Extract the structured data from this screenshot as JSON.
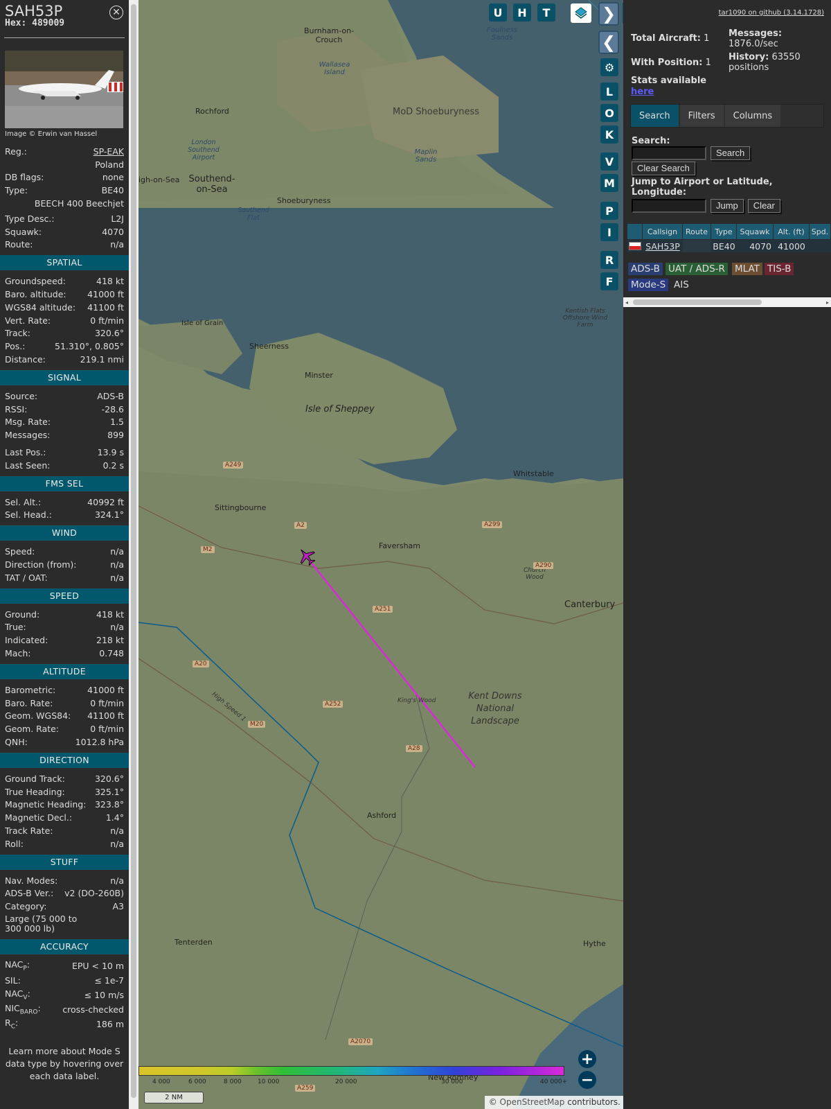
{
  "sidebar": {
    "callsign": "SAH53P",
    "hex_label": "Hex:",
    "hex": "489009",
    "image_credit": "Image © Erwin van Hassel",
    "reg_label": "Reg.:",
    "reg": "SP-EAK",
    "country": "Poland",
    "dbflags_label": "DB flags:",
    "dbflags": "none",
    "type_label": "Type:",
    "type": "BE40",
    "type_full": "BEECH 400 Beechjet",
    "typedesc_label": "Type Desc.:",
    "typedesc": "L2J",
    "squawk_label": "Squawk:",
    "squawk": "4070",
    "route_label": "Route:",
    "route": "n/a",
    "spatial_title": "SPATIAL",
    "gs_label": "Groundspeed:",
    "gs": "418 kt",
    "baro_label": "Baro. altitude:",
    "baro": "41000 ft",
    "wgs_label": "WGS84 altitude:",
    "wgs": "41100 ft",
    "vr_label": "Vert. Rate:",
    "vr": "0 ft/min",
    "track_label": "Track:",
    "track": "320.6°",
    "pos_label": "Pos.:",
    "pos": "51.310°, 0.805°",
    "dist_label": "Distance:",
    "dist": "219.1 nmi",
    "signal_title": "SIGNAL",
    "source_label": "Source:",
    "source": "ADS-B",
    "rssi_label": "RSSI:",
    "rssi": "-28.6",
    "msgrate_label": "Msg. Rate:",
    "msgrate": "1.5",
    "messages_label": "Messages:",
    "messages": "899",
    "lastpos_label": "Last Pos.:",
    "lastpos": "13.9 s",
    "lastseen_label": "Last Seen:",
    "lastseen": "0.2 s",
    "fms_title": "FMS SEL",
    "selalt_label": "Sel. Alt.:",
    "selalt": "40992 ft",
    "selhead_label": "Sel. Head.:",
    "selhead": "324.1°",
    "wind_title": "WIND",
    "wspeed_label": "Speed:",
    "wspeed": "n/a",
    "wdir_label": "Direction (from):",
    "wdir": "n/a",
    "tat_label": "TAT / OAT:",
    "tat": "n/a",
    "speed_title": "SPEED",
    "ground_label": "Ground:",
    "ground": "418 kt",
    "true_label": "True:",
    "true": "n/a",
    "ias_label": "Indicated:",
    "ias": "218 kt",
    "mach_label": "Mach:",
    "mach": "0.748",
    "alt_title": "ALTITUDE",
    "abaro_label": "Barometric:",
    "abaro": "41000 ft",
    "abrate_label": "Baro. Rate:",
    "abrate": "0 ft/min",
    "ageom_label": "Geom. WGS84:",
    "ageom": "41100 ft",
    "agrate_label": "Geom. Rate:",
    "agrate": "0 ft/min",
    "qnh_label": "QNH:",
    "qnh": "1012.8 hPa",
    "dir_title": "DIRECTION",
    "gtrack_label": "Ground Track:",
    "gtrack": "320.6°",
    "thead_label": "True Heading:",
    "thead": "325.1°",
    "mhead_label": "Magnetic Heading:",
    "mhead": "323.8°",
    "mdecl_label": "Magnetic Decl.:",
    "mdecl": "1.4°",
    "trate_label": "Track Rate:",
    "trate": "n/a",
    "roll_label": "Roll:",
    "roll": "n/a",
    "stuff_title": "STUFF",
    "navmodes_label": "Nav. Modes:",
    "navmodes": "n/a",
    "adsbver_label": "ADS-B Ver.:",
    "adsbver": "v2 (DO-260B)",
    "category_label": "Category:",
    "category": "A3",
    "category_desc": "Large (75 000 to 300 000 lb)",
    "acc_title": "ACCURACY",
    "nacp_label": "NAC",
    "nacp_sub": "P",
    "nacp": "EPU < 10 m",
    "sil_label": "SIL:",
    "sil": "≤ 1e-7",
    "nacv_label": "NAC",
    "nacv_sub": "V",
    "nacv": "≤ 10 m/s",
    "nicbaro_label": "NIC",
    "nicbaro_sub": "BARO",
    "nicbaro": "cross-checked",
    "rc_label": "R",
    "rc_sub": "C",
    "rc": "186 m",
    "info": "Learn more about Mode S data type by hovering over each data label."
  },
  "map": {
    "buttons_top": [
      "U",
      "H",
      "T"
    ],
    "buttons_side": [
      "L",
      "O",
      "K",
      "V",
      "M",
      "P",
      "I",
      "R",
      "F"
    ],
    "labels": {
      "burnham": "Burnham-on-Crouch",
      "wallasea": "Wallasea Island",
      "foulness": "Foulness Sands",
      "rochford": "Rochford",
      "mod": "MoD Shoeburyness",
      "london_southend": "London Southend Airport",
      "southend": "Southend-on-Sea",
      "shoeburyness": "Shoeburyness",
      "maplin": "Maplin Sands",
      "southend_flat": "Southend Flat",
      "leigh": "igh-on-Sea",
      "grain": "Isle of Grain",
      "sheerness": "Sheerness",
      "minster": "Minster",
      "sheppey": "Isle of Sheppey",
      "kentish": "Kentish Flats Offshore Wind Farm",
      "whitstable": "Whitstable",
      "sittingbourne": "Sittingbourne",
      "faversham": "Faversham",
      "church_wood": "Church Wood",
      "canterbury": "Canterbury",
      "kings_wood": "King's Wood",
      "kent_downs": "Kent Downs National Landscape",
      "ashford": "Ashford",
      "tenterden": "Tenterden",
      "hythe": "Hythe",
      "new_romney": "New Romney",
      "high_speed": "High Speed 1"
    },
    "roads": [
      "A249",
      "A2",
      "A299",
      "M2",
      "A290",
      "A251",
      "A20",
      "A252",
      "M20",
      "A28",
      "A2070",
      "A259"
    ],
    "legend_ticks": [
      "4 000",
      "6 000",
      "8 000",
      "10 000",
      "20 000",
      "30 000",
      "40 000+"
    ],
    "scale": "2 NM",
    "attrib_sym": "©",
    "attrib_link": "OpenStreetMap",
    "attrib_text": "contributors."
  },
  "right": {
    "gh": "tar1090 on github (3.14.1728)",
    "total_label": "Total Aircraft:",
    "total": "1",
    "withpos_label": "With Position:",
    "withpos": "1",
    "stats_label": "Stats available",
    "stats_link": "here",
    "messages_label": "Messages:",
    "messages": "1876.0/sec",
    "history_label": "History:",
    "history": "63550 positions",
    "tabs": [
      "Search",
      "Filters",
      "Columns"
    ],
    "search_label": "Search:",
    "search_btn": "Search",
    "clear_btn": "Clear Search",
    "jump_label": "Jump to Airport or Latitude, Longitude:",
    "jump_btn": "Jump",
    "clear2_btn": "Clear",
    "columns": [
      "Callsign",
      "Route",
      "Type",
      "Squawk",
      "Alt. (ft)",
      "Spd."
    ],
    "rows": [
      {
        "callsign": "SAH53P",
        "route": "",
        "type": "BE40",
        "squawk": "4070",
        "alt": "41000",
        "spd": ""
      }
    ],
    "sources": [
      "ADS-B",
      "UAT / ADS-R",
      "MLAT",
      "TIS-B",
      "Mode-S",
      "AIS"
    ]
  }
}
